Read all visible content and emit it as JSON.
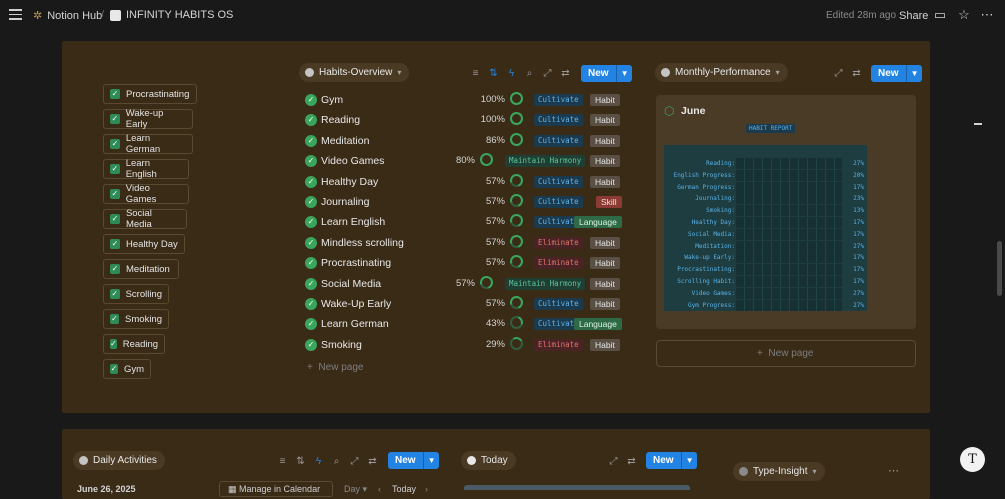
{
  "topbar": {
    "workspace": "Notion Hub",
    "page_title": "INFINITY HABITS OS",
    "edited": "Edited 28m ago",
    "share": "Share"
  },
  "sidebar_habits": [
    "Procrastinating",
    "Wake-up Early",
    "Learn German",
    "Learn English",
    "Video Games",
    "Social Media",
    "Healthy Day",
    "Meditation",
    "Scrolling",
    "Smoking",
    "Reading",
    "Gym"
  ],
  "overview": {
    "title": "Habits-Overview",
    "new_label": "New",
    "new_page": "New page",
    "rows": [
      {
        "name": "Gym",
        "pct": "100%",
        "tag": "Cultivate",
        "tagtype": "cult",
        "cat": "Habit",
        "cattype": "habit",
        "progress": 1.0
      },
      {
        "name": "Reading",
        "pct": "100%",
        "tag": "Cultivate",
        "tagtype": "cult",
        "cat": "Habit",
        "cattype": "habit",
        "progress": 1.0
      },
      {
        "name": "Meditation",
        "pct": "86%",
        "tag": "Cultivate",
        "tagtype": "cult",
        "cat": "Habit",
        "cattype": "habit",
        "progress": 0.86
      },
      {
        "name": "Video Games",
        "pct": "80%",
        "tag": "Maintain Harmony",
        "tagtype": "harm",
        "cat": "Habit",
        "cattype": "habit",
        "progress": 0.8
      },
      {
        "name": "Healthy Day",
        "pct": "57%",
        "tag": "Cultivate",
        "tagtype": "cult",
        "cat": "Habit",
        "cattype": "habit",
        "progress": 0.57
      },
      {
        "name": "Journaling",
        "pct": "57%",
        "tag": "Cultivate",
        "tagtype": "cult",
        "cat": "Skill",
        "cattype": "skill",
        "progress": 0.57
      },
      {
        "name": "Learn English",
        "pct": "57%",
        "tag": "Cultivate",
        "tagtype": "cult",
        "cat": "Language",
        "cattype": "lang",
        "progress": 0.57
      },
      {
        "name": "Mindless scrolling",
        "pct": "57%",
        "tag": "Eliminate",
        "tagtype": "elim",
        "cat": "Habit",
        "cattype": "habit",
        "progress": 0.57
      },
      {
        "name": "Procrastinating",
        "pct": "57%",
        "tag": "Eliminate",
        "tagtype": "elim",
        "cat": "Habit",
        "cattype": "habit",
        "progress": 0.57
      },
      {
        "name": "Social Media",
        "pct": "57%",
        "tag": "Maintain Harmony",
        "tagtype": "harm",
        "cat": "Habit",
        "cattype": "habit",
        "progress": 0.57
      },
      {
        "name": "Wake-Up Early",
        "pct": "57%",
        "tag": "Cultivate",
        "tagtype": "cult",
        "cat": "Habit",
        "cattype": "habit",
        "progress": 0.57
      },
      {
        "name": "Learn German",
        "pct": "43%",
        "tag": "Cultivate",
        "tagtype": "cult",
        "cat": "Language",
        "cattype": "lang",
        "progress": 0.43
      },
      {
        "name": "Smoking",
        "pct": "29%",
        "tag": "Eliminate",
        "tagtype": "elim",
        "cat": "Habit",
        "cattype": "habit",
        "progress": 0.29
      }
    ]
  },
  "monthly": {
    "title": "Monthly-Performance",
    "new_label": "New",
    "card_title": "June",
    "report_title": "HABIT REPORT",
    "new_page": "New page",
    "report_rows": [
      {
        "label": "Reading:",
        "value": "27%"
      },
      {
        "label": "English Progress:",
        "value": "20%"
      },
      {
        "label": "German Progress:",
        "value": "17%"
      },
      {
        "label": "Journaling:",
        "value": "23%"
      },
      {
        "label": "Smoking:",
        "value": "13%"
      },
      {
        "label": "Healthy Day:",
        "value": "17%"
      },
      {
        "label": "Social Media:",
        "value": "17%"
      },
      {
        "label": "Meditation:",
        "value": "27%"
      },
      {
        "label": "Wake-up Early:",
        "value": "17%"
      },
      {
        "label": "Procrastinating:",
        "value": "17%"
      },
      {
        "label": "Scrolling Habit:",
        "value": "17%"
      },
      {
        "label": "Video Games:",
        "value": "27%"
      },
      {
        "label": "Gym Progress:",
        "value": "27%"
      }
    ]
  },
  "bottom": {
    "daily": "Daily Activities",
    "today": "Today",
    "type_insight": "Type-Insight",
    "new_label": "New",
    "date": "June 26, 2025",
    "manage": "Manage in Calendar",
    "day": "Day",
    "today_nav": "Today"
  }
}
